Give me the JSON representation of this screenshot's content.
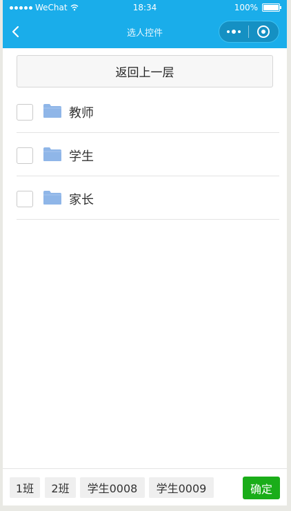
{
  "status_bar": {
    "carrier": "WeChat",
    "time": "18:34",
    "battery": "100%"
  },
  "nav": {
    "title": "选人控件"
  },
  "back_button": {
    "label": "返回上一层"
  },
  "items": [
    {
      "label": "教师"
    },
    {
      "label": "学生"
    },
    {
      "label": "家长"
    }
  ],
  "selected_chips": [
    "1班",
    "2班",
    "学生0008",
    "学生0009"
  ],
  "confirm": {
    "label": "确定"
  },
  "colors": {
    "nav_bg": "#1aadea",
    "confirm_bg": "#1aad19",
    "folder": "#8fb6e8"
  }
}
